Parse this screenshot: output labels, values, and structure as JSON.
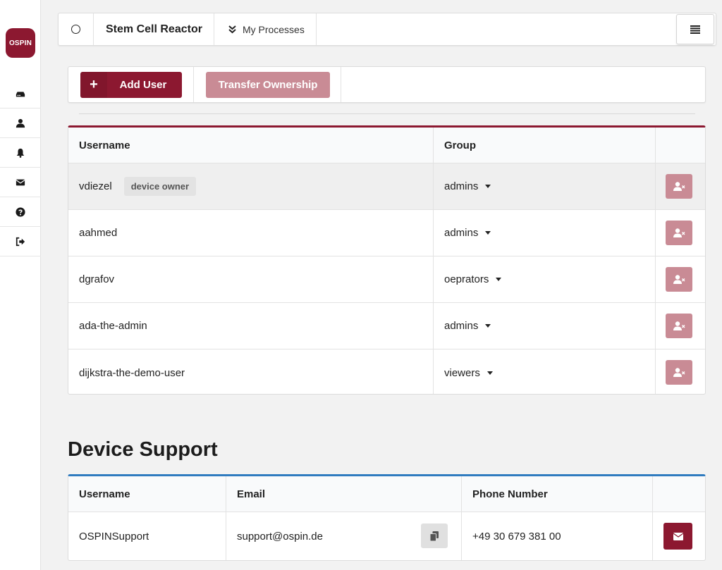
{
  "app": {
    "logo_text": "OSPIN",
    "accent_color": "#8c1830",
    "accent_light": "#c98b95",
    "support_accent": "#2f7bbf"
  },
  "sidebar": {
    "items": [
      {
        "icon": "device-icon"
      },
      {
        "icon": "user-icon"
      },
      {
        "icon": "bell-icon"
      },
      {
        "icon": "envelope-icon"
      },
      {
        "icon": "question-circle-icon"
      },
      {
        "icon": "sign-out-icon"
      }
    ]
  },
  "topbar": {
    "device_name": "Stem Cell Reactor",
    "processes_label": "My Processes"
  },
  "actions": {
    "add_user": "Add User",
    "add_icon": "+",
    "transfer_ownership": "Transfer Ownership"
  },
  "users_table": {
    "headers": {
      "username": "Username",
      "group": "Group"
    },
    "rows": [
      {
        "username": "vdiezel",
        "badge": "device owner",
        "group": "admins"
      },
      {
        "username": "aahmed",
        "group": "admins"
      },
      {
        "username": "dgrafov",
        "group": "oeprators"
      },
      {
        "username": "ada-the-admin",
        "group": "admins"
      },
      {
        "username": "dijkstra-the-demo-user",
        "group": "viewers"
      }
    ]
  },
  "support": {
    "title": "Device Support",
    "headers": {
      "username": "Username",
      "email": "Email",
      "phone": "Phone Number"
    },
    "row": {
      "username": "OSPINSupport",
      "email": "support@ospin.de",
      "phone": "+49 30 679 381 00"
    }
  }
}
